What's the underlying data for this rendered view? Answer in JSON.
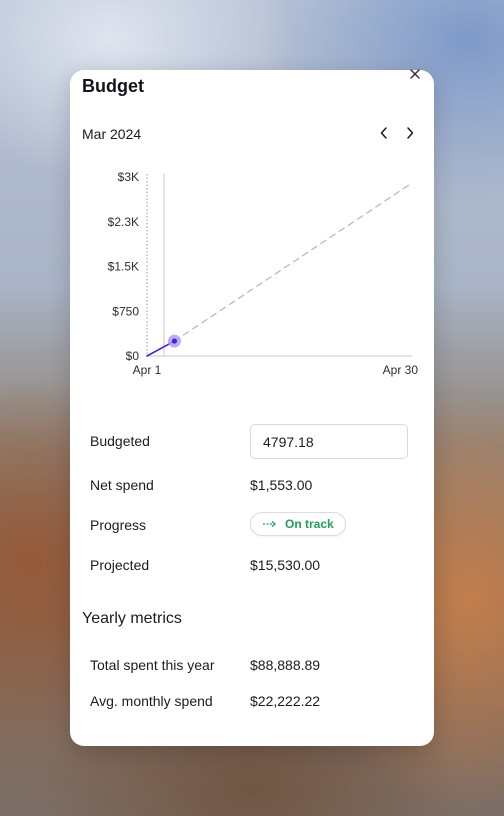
{
  "card": {
    "title": "Budget",
    "month": "Mar 2024"
  },
  "icons": {
    "close": "close-icon",
    "prev": "chevron-left-icon",
    "next": "chevron-right-icon",
    "status": "arrow-right-icon"
  },
  "chart_data": {
    "type": "line",
    "y_tick_labels": [
      "$3K",
      "$2.3K",
      "$1.5K",
      "$750",
      "$0"
    ],
    "y_ticks": [
      3000,
      2250,
      1500,
      750,
      0
    ],
    "x_tick_labels": [
      "Apr 1",
      "Apr 30"
    ],
    "ylim": [
      0,
      3000
    ],
    "xlim": [
      1,
      30
    ],
    "series": [
      {
        "style": "actual",
        "points": [
          [
            1,
            0
          ],
          [
            4,
            250
          ]
        ]
      },
      {
        "style": "projected-dashed",
        "points": [
          [
            4,
            250
          ],
          [
            30,
            2900
          ]
        ]
      }
    ],
    "current_point": {
      "x": 4,
      "y": 250
    },
    "colors": {
      "actual": "#4a22d6",
      "projected": "#b9b9c0",
      "marker": "#b39cf3"
    }
  },
  "details": {
    "budgeted_label": "Budgeted",
    "budgeted_value": "4797.18",
    "net_spend_label": "Net spend",
    "net_spend_value": "$1,553.00",
    "progress_label": "Progress",
    "progress_status": "On track",
    "projected_label": "Projected",
    "projected_value": "$15,530.00"
  },
  "yearly": {
    "section_title": "Yearly metrics",
    "total_label": "Total spent this year",
    "total_value": "$88,888.89",
    "avg_label": "Avg. monthly spend",
    "avg_value": "$22,222.22"
  },
  "colors": {
    "on_track": "#1f9e5c"
  }
}
